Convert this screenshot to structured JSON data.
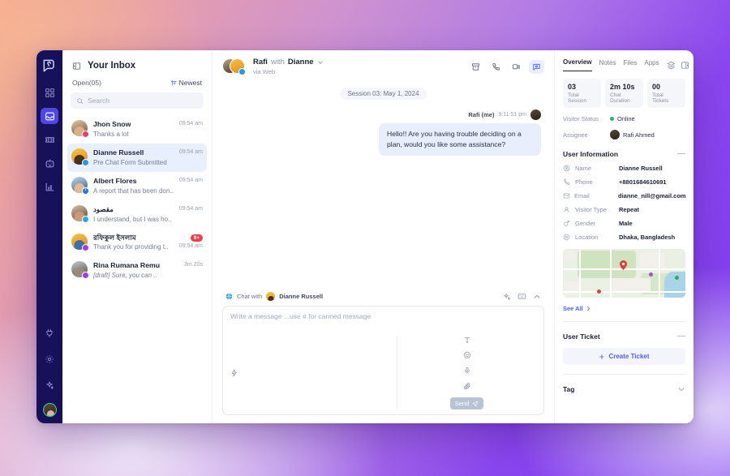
{
  "rail": {
    "logo": "app-logo",
    "items": [
      {
        "name": "dashboard",
        "icon": "grid-icon",
        "active": false
      },
      {
        "name": "inbox",
        "icon": "inbox-icon",
        "active": true
      },
      {
        "name": "tickets",
        "icon": "ticket-icon",
        "active": false
      },
      {
        "name": "bot",
        "icon": "robot-icon",
        "active": false
      },
      {
        "name": "reports",
        "icon": "bar-chart-icon",
        "active": false
      }
    ],
    "bottom": [
      {
        "name": "integrations",
        "icon": "plug-icon"
      },
      {
        "name": "settings",
        "icon": "gear-icon"
      },
      {
        "name": "ai",
        "icon": "sparkle-icon"
      }
    ]
  },
  "inbox": {
    "title": "Your Inbox",
    "panel_icon": "panel-collapse-icon",
    "open_count_label": "Open(05)",
    "sort_label": "Newest",
    "search_placeholder": "Search",
    "search_value": "",
    "conversations": [
      {
        "name": "Jhon Snow",
        "preview": "Thanks a lot",
        "time": "09:54 am",
        "source": "instagram",
        "source_color": "#e4405f",
        "avatar_from": "#e8c9a8",
        "avatar_to": "#6b4a30",
        "active": false,
        "unread": "",
        "draft": false
      },
      {
        "name": "Dianne Russell",
        "preview": "Pre Chat Form Submitted",
        "time": "09:54 am",
        "source": "web",
        "source_color": "#1d9bf0",
        "avatar_from": "#f5c242",
        "avatar_to": "#e08f1c",
        "active": true,
        "unread": "",
        "draft": false
      },
      {
        "name": "Albert Flores",
        "preview": "A report that has been don..",
        "time": "09:54 am",
        "source": "facebook",
        "source_color": "#1877f2",
        "avatar_from": "#bcd8f0",
        "avatar_to": "#3a5a78",
        "active": false,
        "unread": "",
        "draft": false
      },
      {
        "name": "مقصود",
        "preview": "I understand, but I was ho..",
        "time": "09:54 am",
        "source": "telegram",
        "source_color": "#29a9eb",
        "avatar_from": "#d6c0a8",
        "avatar_to": "#5a4030",
        "active": false,
        "unread": "",
        "draft": false
      },
      {
        "name": "রফিকুল ইসলাম",
        "preview": "Thank you for providing t..",
        "time": "09:54 am",
        "source": "messenger",
        "source_color": "#a33ce8",
        "avatar_from": "#f5c242",
        "avatar_to": "#d98a1c",
        "active": false,
        "unread": "9+",
        "draft": false
      },
      {
        "name": "Rina Rumana Remu",
        "preview": "[draft] Sure, you can ..",
        "time": "3m 20s",
        "source": "messenger",
        "source_color": "#a33ce8",
        "avatar_from": "#c9c9c9",
        "avatar_to": "#4a4a4a",
        "active": false,
        "unread": "",
        "draft": true
      }
    ]
  },
  "chat": {
    "agent": "Rafi",
    "with_word": "with",
    "customer": "Dianne",
    "dropdown_icon": "chevron-down-icon",
    "channel": "via Web",
    "actions": [
      {
        "name": "archive",
        "icon": "archive-icon",
        "active": false
      },
      {
        "name": "call",
        "icon": "phone-icon",
        "active": false
      },
      {
        "name": "video",
        "icon": "video-icon",
        "active": false
      },
      {
        "name": "chat",
        "icon": "chat-bubble-icon",
        "active": true
      }
    ],
    "session_chip": "Session 03: May 1, 2024",
    "messages": [
      {
        "sender": "Rafi (me)",
        "time": "9:11:51 pm",
        "text": "Hello!!  Are you having trouble deciding on a plan, would you like some assistance?",
        "outgoing": true
      }
    ]
  },
  "composer": {
    "chat_with_label": "Chat with",
    "chat_with_name": "Dianne Russell",
    "source_icon": "globe-icon",
    "top_actions": [
      {
        "name": "ai-assist",
        "icon": "sparkle-icon"
      },
      {
        "name": "keyboard",
        "icon": "keyboard-icon"
      },
      {
        "name": "collapse",
        "icon": "chevron-up-icon"
      }
    ],
    "placeholder": "Write a message ...use # for canned message",
    "value": "",
    "bar_left_icon": "lightning-icon",
    "bar_right_icons": [
      {
        "name": "text-format",
        "icon": "text-format-icon"
      },
      {
        "name": "emoji",
        "icon": "emoji-icon"
      },
      {
        "name": "voice",
        "icon": "microphone-icon"
      },
      {
        "name": "attachment",
        "icon": "paperclip-icon"
      }
    ],
    "send_label": "Send",
    "send_icon": "send-icon"
  },
  "right": {
    "tabs": [
      {
        "label": "Overview",
        "active": true
      },
      {
        "label": "Notes",
        "active": false
      },
      {
        "label": "Files",
        "active": false
      },
      {
        "label": "Apps",
        "active": false
      }
    ],
    "tail_icons": [
      {
        "name": "layers",
        "icon": "layers-icon"
      },
      {
        "name": "panel-toggle",
        "icon": "panel-right-icon"
      }
    ],
    "stats": [
      {
        "value": "03",
        "label": "Total Session"
      },
      {
        "value": "2m 10s",
        "label": "Chat Duration"
      },
      {
        "value": "00",
        "label": "Total Tickets"
      }
    ],
    "visitor_status_label": "Visitor Status",
    "visitor_status_value": "Online",
    "assignee_label": "Assignee",
    "assignee_value": "Rafi Ahmed",
    "user_information": {
      "title": "User Information",
      "collapse_icon": "minus-icon",
      "rows": [
        {
          "icon": "user-circle-icon",
          "label": "Name",
          "value": "Dianne Russell"
        },
        {
          "icon": "phone-icon",
          "label": "Phone",
          "value": "+8801684610691"
        },
        {
          "icon": "mail-icon",
          "label": "Email",
          "value": "dianne_nill@gmail.com"
        },
        {
          "icon": "user-icon",
          "label": "Visitor Type",
          "value": "Repeat"
        },
        {
          "icon": "gender-icon",
          "label": "Gender",
          "value": "Male"
        },
        {
          "icon": "location-icon",
          "label": "Location",
          "value": "Dhaka, Bangladesh"
        }
      ],
      "see_all_label": "See All",
      "see_all_icon": "chevron-right-icon",
      "map_pin": "map-pin-marker"
    },
    "user_ticket": {
      "title": "User Ticket",
      "collapse_icon": "minus-icon",
      "create_label": "Create Ticket",
      "create_icon": "plus-icon"
    },
    "tag": {
      "title": "Tag",
      "expand_icon": "chevron-down-icon"
    }
  },
  "colors": {
    "accent": "#4f46e5",
    "rail_bg": "#171159",
    "link": "#4a61f0",
    "online": "#22b573",
    "unread": "#ef3e4a",
    "bubble": "#e8eefc",
    "active_row": "#e8efff"
  }
}
